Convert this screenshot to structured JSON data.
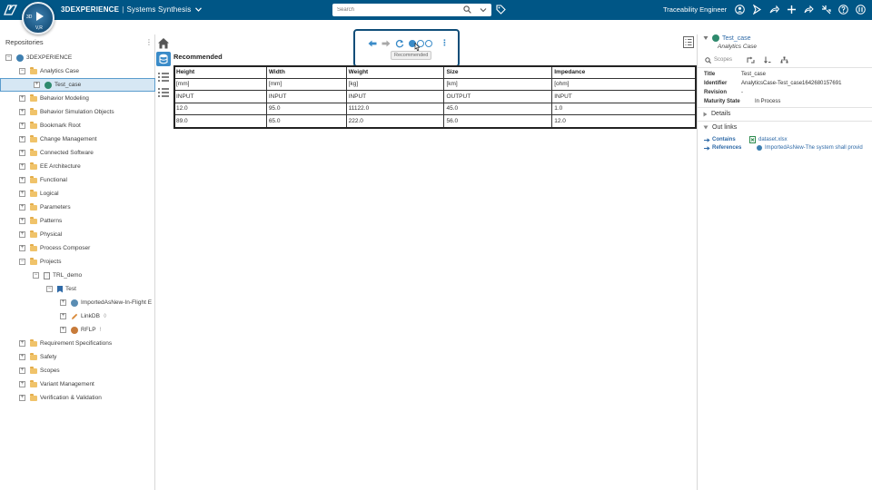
{
  "header": {
    "brand_name": "3DEXPERIENCE",
    "separator": "|",
    "app_name": "Systems Synthesis",
    "compass_label_3d": "3D",
    "compass_label_vr": "V,R",
    "search_placeholder": "Search",
    "role": "Traceability Engineer",
    "colors": {
      "bar": "#005686"
    }
  },
  "left_panel": {
    "title": "Repositories",
    "tree": [
      {
        "label": "3DEXPERIENCE",
        "level": 0,
        "expander": "−",
        "icon": "globe"
      },
      {
        "label": "Analytics Case",
        "level": 1,
        "expander": "−",
        "icon": "folder"
      },
      {
        "label": "Test_case",
        "level": 2,
        "expander": "+",
        "icon": "green-globe",
        "selected": true
      },
      {
        "label": "Behavior Modeling",
        "level": 1,
        "expander": "+",
        "icon": "folder"
      },
      {
        "label": "Behavior Simulation Objects",
        "level": 1,
        "expander": "+",
        "icon": "folder"
      },
      {
        "label": "Bookmark Root",
        "level": 1,
        "expander": "+",
        "icon": "folder"
      },
      {
        "label": "Change Management",
        "level": 1,
        "expander": "+",
        "icon": "folder"
      },
      {
        "label": "Connected Software",
        "level": 1,
        "expander": "+",
        "icon": "folder"
      },
      {
        "label": "EE Architecture",
        "level": 1,
        "expander": "+",
        "icon": "folder"
      },
      {
        "label": "Functional",
        "level": 1,
        "expander": "+",
        "icon": "folder"
      },
      {
        "label": "Logical",
        "level": 1,
        "expander": "+",
        "icon": "folder"
      },
      {
        "label": "Parameters",
        "level": 1,
        "expander": "+",
        "icon": "folder"
      },
      {
        "label": "Patterns",
        "level": 1,
        "expander": "+",
        "icon": "folder"
      },
      {
        "label": "Physical",
        "level": 1,
        "expander": "+",
        "icon": "folder"
      },
      {
        "label": "Process Composer",
        "level": 1,
        "expander": "+",
        "icon": "folder"
      },
      {
        "label": "Projects",
        "level": 1,
        "expander": "−",
        "icon": "folder"
      },
      {
        "label": "TRL_demo",
        "level": 2,
        "expander": "−",
        "icon": "doc"
      },
      {
        "label": "Test",
        "level": 3,
        "expander": "−",
        "icon": "bookmark"
      },
      {
        "label": "ImportedAsNew-In-Flight E",
        "level": 4,
        "expander": "+",
        "icon": "link-globe"
      },
      {
        "label": "LinkDB",
        "level": 4,
        "expander": "+",
        "icon": "pencil",
        "suffix": "◊"
      },
      {
        "label": "RFLP",
        "level": 4,
        "expander": "+",
        "icon": "rflp",
        "suffix": "!"
      },
      {
        "label": "Requirement Specifications",
        "level": 1,
        "expander": "+",
        "icon": "folder"
      },
      {
        "label": "Safety",
        "level": 1,
        "expander": "+",
        "icon": "folder"
      },
      {
        "label": "Scopes",
        "level": 1,
        "expander": "+",
        "icon": "folder"
      },
      {
        "label": "Variant Management",
        "level": 1,
        "expander": "+",
        "icon": "folder"
      },
      {
        "label": "Verification & Validation",
        "level": 1,
        "expander": "+",
        "icon": "folder"
      }
    ]
  },
  "toolbar": {
    "tooltip": "Recommended",
    "accent": "#3a8bc8"
  },
  "content": {
    "title": "Recommended",
    "table": {
      "headers": [
        "Height",
        "Width",
        "Weight",
        "Size",
        "Impedance"
      ],
      "rows": [
        [
          "[mm]",
          "[mm]",
          "[kg]",
          "[km]",
          "[ohm]"
        ],
        [
          "INPUT",
          "INPUT",
          "INPUT",
          "OUTPUT",
          "INPUT"
        ],
        [
          "12.0",
          "95.0",
          "11122.0",
          "45.0",
          "1.0"
        ],
        [
          "89.0",
          "65.0",
          "222.0",
          "56.0",
          "12.0"
        ]
      ]
    }
  },
  "right_panel": {
    "title": "Test_case",
    "subtitle": "Analytics Case",
    "scopes_label": "Scopes",
    "properties": [
      {
        "key": "Title",
        "value": "Test_case"
      },
      {
        "key": "Identifier",
        "value": "AnalyticsCase-Test_case1642680157691"
      },
      {
        "key": "Revision",
        "value": "-"
      },
      {
        "key": "Maturity State",
        "value": "In Process"
      }
    ],
    "details_label": "Details",
    "outlinks_label": "Out links",
    "links": [
      {
        "key": "Contains",
        "value": "dataset.xlsx"
      },
      {
        "key": "References",
        "value": "ImportedAsNew-The system shall provid"
      }
    ]
  }
}
